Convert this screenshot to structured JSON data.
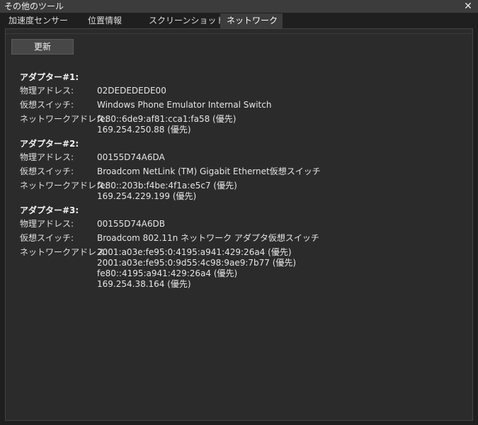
{
  "window": {
    "title": "その他のツール",
    "close_glyph": "✕"
  },
  "tabs": [
    {
      "label": "加速度センサー",
      "active": false
    },
    {
      "label": "位置情報",
      "active": false
    },
    {
      "label": "スクリーンショット",
      "active": false
    },
    {
      "label": "ネットワーク",
      "active": true
    }
  ],
  "toolbar": {
    "refresh_label": "更新"
  },
  "adapters": [
    {
      "title": "アダプター#1:",
      "physical_label": "物理アドレス:",
      "physical_value": "02DEDEDEDE00",
      "switch_label": "仮想スイッチ:",
      "switch_value": "Windows Phone Emulator Internal Switch",
      "network_label": "ネットワークアドレス:",
      "network_values": [
        "fe80::6de9:af81:cca1:fa58 (優先)",
        "169.254.250.88 (優先)"
      ]
    },
    {
      "title": "アダプター#2:",
      "physical_label": "物理アドレス:",
      "physical_value": "00155D74A6DA",
      "switch_label": "仮想スイッチ:",
      "switch_value": "Broadcom NetLink (TM) Gigabit Ethernet仮想スイッチ",
      "network_label": "ネットワークアドレス:",
      "network_values": [
        "fe80::203b:f4be:4f1a:e5c7 (優先)",
        "169.254.229.199 (優先)"
      ]
    },
    {
      "title": "アダプター#3:",
      "physical_label": "物理アドレス:",
      "physical_value": "00155D74A6DB",
      "switch_label": "仮想スイッチ:",
      "switch_value": "Broadcom 802.11n ネットワーク アダプタ仮想スイッチ",
      "network_label": "ネットワークアドレス:",
      "network_values": [
        "2001:a03e:fe95:0:4195:a941:429:26a4 (優先)",
        "2001:a03e:fe95:0:9d55:4c98:9ae9:7b77 (優先)",
        "fe80::4195:a941:429:26a4 (優先)",
        "169.254.38.164 (優先)"
      ]
    }
  ]
}
